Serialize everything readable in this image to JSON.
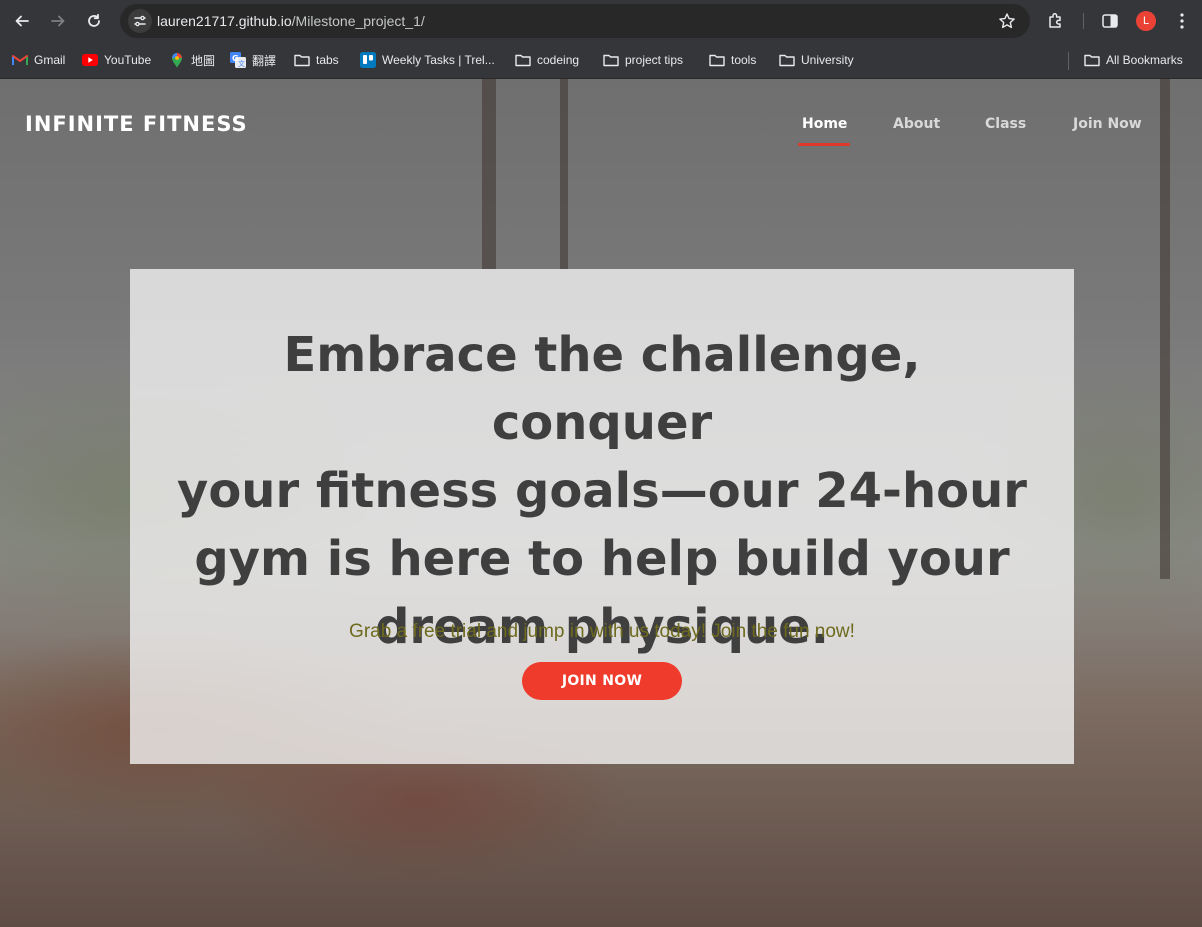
{
  "browser": {
    "url_host": "lauren21717.github.io",
    "url_path": "/Milestone_project_1/",
    "profile_initial": "L",
    "icons": [
      "back-arrow-icon",
      "forward-arrow-icon",
      "reload-icon",
      "site-settings-icon",
      "bookmark-star-icon",
      "extensions-icon",
      "side-panel-icon",
      "profile-avatar",
      "kebab-menu-icon"
    ]
  },
  "bookmarks": [
    {
      "label": "Gmail",
      "icon": "gmail-icon"
    },
    {
      "label": "YouTube",
      "icon": "youtube-icon"
    },
    {
      "label": "地圖",
      "icon": "maps-pin-icon"
    },
    {
      "label": "翻譯",
      "icon": "translate-icon"
    },
    {
      "label": "tabs",
      "icon": "folder-icon"
    },
    {
      "label": "Weekly Tasks | Trel...",
      "icon": "trello-icon"
    },
    {
      "label": "codeing",
      "icon": "folder-icon"
    },
    {
      "label": "project tips",
      "icon": "folder-icon"
    },
    {
      "label": "tools",
      "icon": "folder-icon"
    },
    {
      "label": "University",
      "icon": "folder-icon"
    }
  ],
  "all_bookmarks": "All Bookmarks",
  "site": {
    "brand": "INFINITE FITNESS",
    "nav": {
      "home": "Home",
      "about": "About",
      "class": "Class",
      "join": "Join Now"
    },
    "active_nav": "Home",
    "hero": {
      "title_line1": "Embrace the challenge, conquer",
      "title_line2": "your fitness goals—our 24-hour",
      "title_line3": "gym is here to help build your",
      "title_line4": "dream physique.",
      "subtitle": "Grab a free trial and jump in with us today! Join the fun now!",
      "button": "JOIN NOW"
    }
  },
  "colors": {
    "accent": "#ef3b2c",
    "hero_title": "#3f3f3f",
    "hero_subtitle": "#6e6a1e",
    "chrome_bg": "#35363a"
  }
}
